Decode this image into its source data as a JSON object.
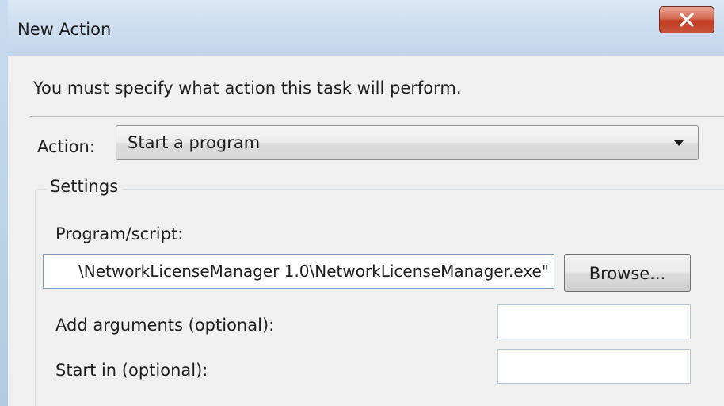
{
  "window": {
    "title": "New Action",
    "close_icon": "close-x-icon"
  },
  "instruction": "You must specify what action this task will perform.",
  "action": {
    "label": "Action:",
    "selected": "Start a program",
    "dropdown_icon": "chevron-down-icon"
  },
  "settings": {
    "legend": "Settings",
    "program": {
      "label": "Program/script:",
      "value": "\\NetworkLicenseManager 1.0\\NetworkLicenseManager.exe\""
    },
    "browse_label": "Browse...",
    "arguments": {
      "label": "Add arguments (optional):",
      "value": ""
    },
    "start_in": {
      "label": "Start in (optional):",
      "value": ""
    }
  },
  "colors": {
    "titlebar": "#cfdff0",
    "close_button": "#c8543a",
    "dialog_background": "#f0f0f0"
  }
}
